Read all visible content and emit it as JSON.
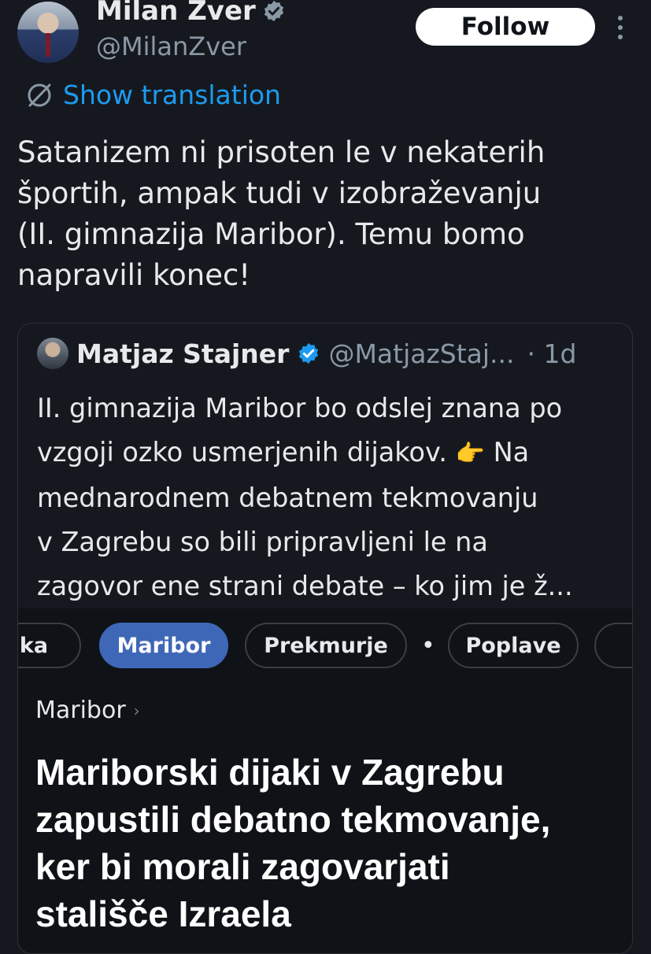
{
  "author": {
    "name": "Milan Zver",
    "handle": "@MilanZver",
    "follow_label": "Follow"
  },
  "translation": {
    "label": "Show translation"
  },
  "tweet": {
    "lines": [
      "Satanizem ni prisoten le v nekaterih",
      "športih, ampak tudi v izobraževanju",
      "(II. gimnazija Maribor). Temu bomo",
      "napravili konec!"
    ]
  },
  "quote": {
    "name": "Matjaz Stajner",
    "handle": "@MatjazStaj...",
    "time": "· 1d",
    "lines": [
      "II. gimnazija Maribor bo odslej znana po",
      "vzgoji ozko usmerjenih dijakov.",
      "Na",
      "mednarodnem debatnem tekmovanju",
      "v Zagrebu so bili pripravljeni le na",
      "zagovor ene strani debate – ko jim je ž..."
    ],
    "emoji": "👉"
  },
  "embed": {
    "chips": [
      "ka",
      "Maribor",
      "Prekmurje",
      "Poplave"
    ],
    "chip_separator": "•",
    "breadcrumb": "Maribor",
    "headline_lines": [
      "Mariborski dijaki v Zagrebu",
      "zapustili debatno tekmovanje,",
      "ker bi morali zagovarjati",
      "stališče Izraela"
    ]
  },
  "colors": {
    "background": "#15191f",
    "link": "#1d9bf0",
    "active_chip": "#3f67b8"
  },
  "icons": {
    "verified_author": "verified-badge-gray",
    "verified_quote": "verified-badge-blue",
    "translate": "translate-globe-icon",
    "more": "more-vertical-icon"
  }
}
